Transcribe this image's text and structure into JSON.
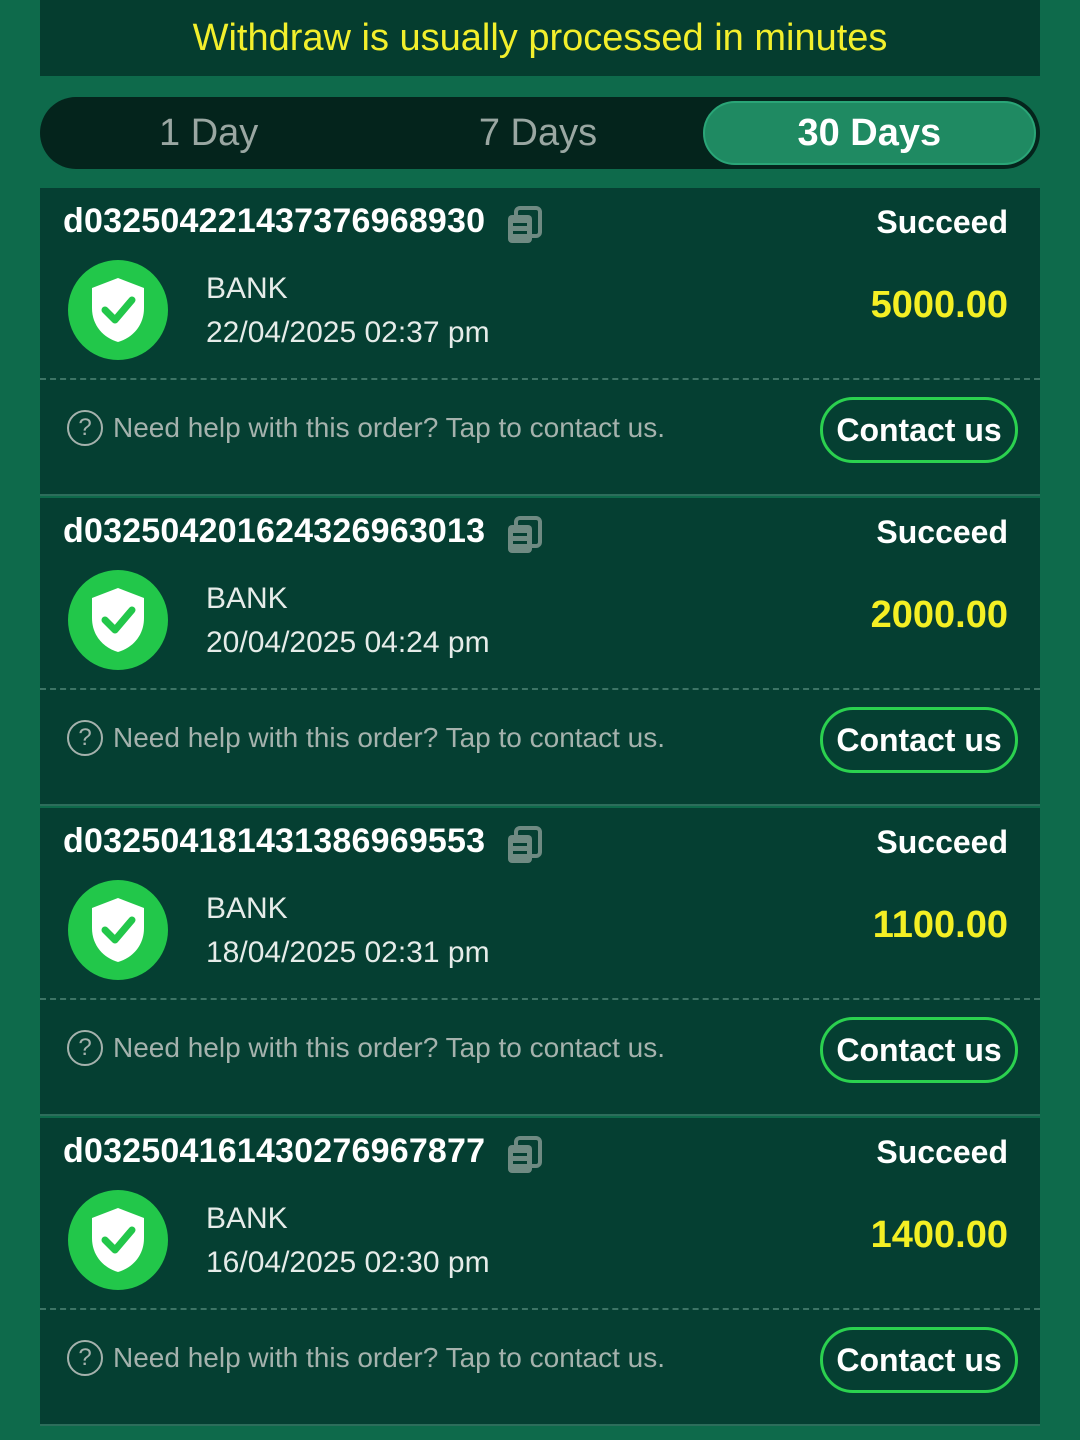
{
  "notice": "Withdraw is usually processed in minutes",
  "tabs": [
    {
      "label": "1 Day",
      "active": false
    },
    {
      "label": "7 Days",
      "active": false
    },
    {
      "label": "30 Days",
      "active": true
    }
  ],
  "orders": [
    {
      "id": "d03250422143737696893​0",
      "status": "Succeed",
      "method": "BANK",
      "datetime": "22/04/2025 02:37 pm",
      "amount": "5000.00"
    },
    {
      "id": "d032504201624326963013",
      "status": "Succeed",
      "method": "BANK",
      "datetime": "20/04/2025 04:24 pm",
      "amount": "2000.00"
    },
    {
      "id": "d032504181431386969553",
      "status": "Succeed",
      "method": "BANK",
      "datetime": "18/04/2025 02:31 pm",
      "amount": "1100.00"
    },
    {
      "id": "d032504161430276967877",
      "status": "Succeed",
      "method": "BANK",
      "datetime": "16/04/2025 02:30 pm",
      "amount": "1400.00"
    }
  ],
  "help_text": "Need help with this order? Tap to contact us.",
  "contact_label": "Contact us",
  "help_glyph": "?",
  "colors": {
    "background": "#0e6a4b",
    "card": "#053f32",
    "amount": "#f4ef24",
    "notice_text": "#f2ef2c",
    "success": "#22c74a"
  }
}
